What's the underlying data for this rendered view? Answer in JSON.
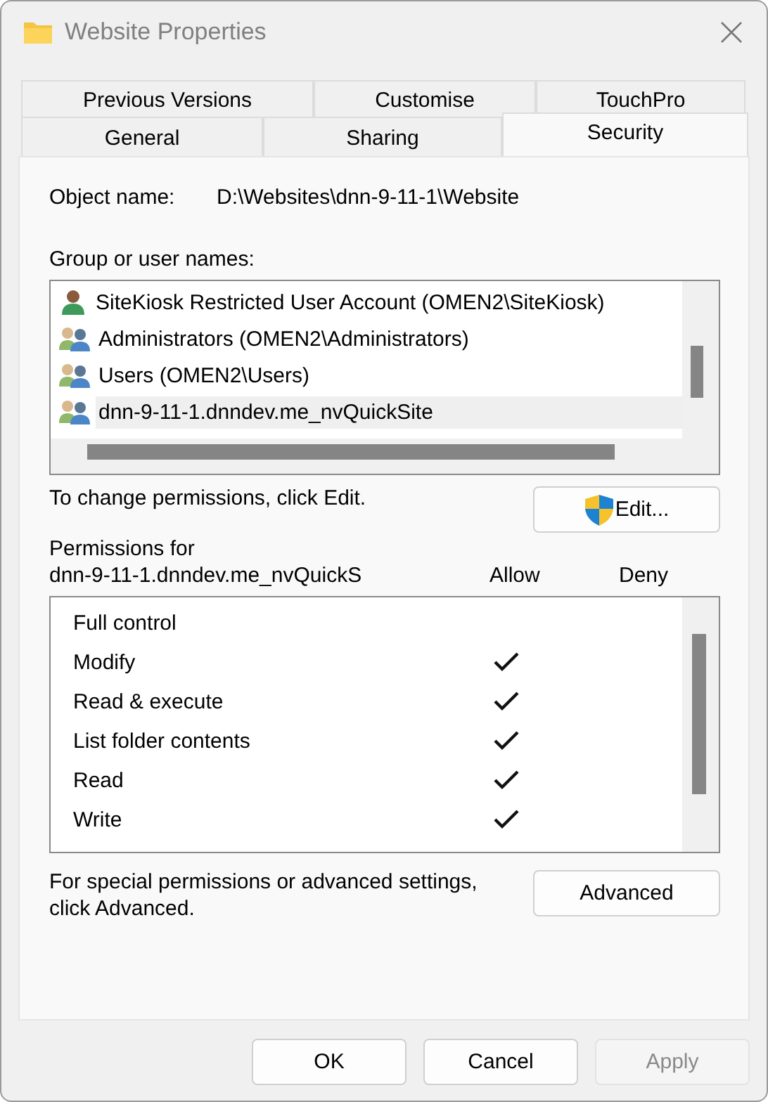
{
  "window": {
    "title": "Website Properties"
  },
  "tab_rows": [
    [
      {
        "label": "Previous Versions",
        "selected": false
      },
      {
        "label": "Customise",
        "selected": false
      },
      {
        "label": "TouchPro",
        "selected": false
      }
    ],
    [
      {
        "label": "General",
        "selected": false
      },
      {
        "label": "Sharing",
        "selected": false
      },
      {
        "label": "Security",
        "selected": true
      }
    ]
  ],
  "object_name": {
    "label": "Object name:",
    "value": "D:\\Websites\\dnn-9-11-1\\Website"
  },
  "group_list": {
    "label": "Group or user names:",
    "items": [
      {
        "name": "SiteKiosk Restricted User Account (OMEN2\\SiteKiosk)",
        "kind": "user",
        "selected": false
      },
      {
        "name": "Administrators (OMEN2\\Administrators)",
        "kind": "group",
        "selected": false
      },
      {
        "name": "Users (OMEN2\\Users)",
        "kind": "group",
        "selected": false
      },
      {
        "name": "dnn-9-11-1.dnndev.me_nvQuickSite",
        "kind": "group",
        "selected": true
      }
    ]
  },
  "change_hint": "To change permissions, click Edit.",
  "edit_button": "Edit...",
  "permissions": {
    "label": "Permissions for",
    "principal": "dnn-9-11-1.dnndev.me_nvQuickS",
    "allow_header": "Allow",
    "deny_header": "Deny",
    "rows": [
      {
        "name": "Full control",
        "allow": false,
        "deny": false
      },
      {
        "name": "Modify",
        "allow": true,
        "deny": false
      },
      {
        "name": "Read & execute",
        "allow": true,
        "deny": false
      },
      {
        "name": "List folder contents",
        "allow": true,
        "deny": false
      },
      {
        "name": "Read",
        "allow": true,
        "deny": false
      },
      {
        "name": "Write",
        "allow": true,
        "deny": false
      }
    ]
  },
  "advanced_hint": "For special permissions or advanced settings, click Advanced.",
  "advanced_button": "Advanced",
  "buttons": [
    {
      "label": "OK",
      "disabled": false
    },
    {
      "label": "Cancel",
      "disabled": false
    },
    {
      "label": "Apply",
      "disabled": true
    }
  ]
}
